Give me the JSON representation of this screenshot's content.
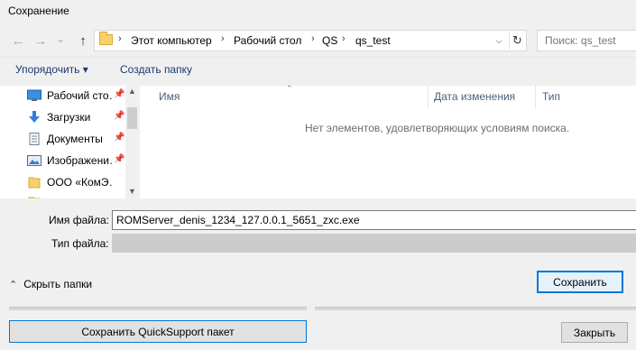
{
  "window": {
    "title": "Сохранение"
  },
  "nav": {
    "back_icon": "←",
    "forward_icon": "→",
    "dropdown_icon": "⌄",
    "up_icon": "↑"
  },
  "address": {
    "crumbs": [
      "Этот компьютер",
      "Рабочий стол",
      "QS",
      "qs_test"
    ],
    "separator": "›"
  },
  "search": {
    "placeholder": "Поиск: qs_test"
  },
  "toolbar": {
    "organize_label": "Упорядочить ▾",
    "new_folder_label": "Создать папку"
  },
  "sidebar": {
    "items": [
      {
        "label": "Рабочий сто…",
        "icon": "desktop-icon",
        "pinned": true
      },
      {
        "label": "Загрузки",
        "icon": "download-icon",
        "pinned": true
      },
      {
        "label": "Документы",
        "icon": "documents-icon",
        "pinned": true
      },
      {
        "label": "Изображени…",
        "icon": "pictures-icon",
        "pinned": true
      },
      {
        "label": "ООО «КомЭ…",
        "icon": "folder-icon",
        "pinned": false
      }
    ]
  },
  "columns": [
    "Имя",
    "Дата изменения",
    "Тип"
  ],
  "empty_message": "Нет элементов, удовлетворяющих условиям поиска.",
  "form": {
    "filename_label": "Имя файла:",
    "filename_value": "ROMServer_denis_1234_127.0.0.1_5651_zxc.exe",
    "filetype_label": "Тип файла:"
  },
  "footer": {
    "hide_folders_label": "Скрыть папки",
    "save_label": "Сохранить",
    "save_qs_label": "Сохранить QuickSupport пакет",
    "close_label": "Закрыть"
  },
  "colors": {
    "accent": "#0078d7",
    "folder": "#f7cf6c"
  }
}
